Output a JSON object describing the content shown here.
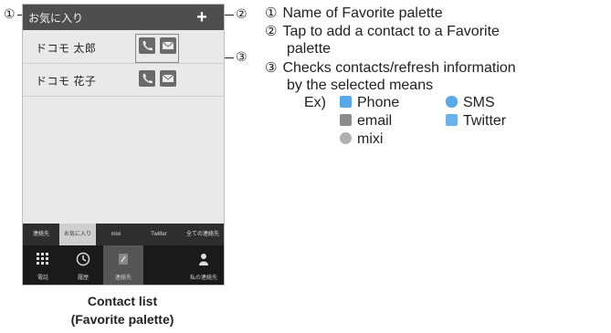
{
  "phone": {
    "palette_name": "お気に入り",
    "add_symbol": "+",
    "contacts": [
      {
        "name": "ドコモ 太郎"
      },
      {
        "name": "ドコモ 花子"
      }
    ],
    "tabs": [
      {
        "label": "連絡先"
      },
      {
        "label": "お気に入り"
      },
      {
        "label": "mixi"
      },
      {
        "label": "Twitter"
      },
      {
        "label": "全ての連絡先"
      }
    ],
    "bottom_tabs": [
      {
        "label": "電話",
        "icon": "dialpad-icon"
      },
      {
        "label": "履歴",
        "icon": "clock-icon"
      },
      {
        "label": "連絡先",
        "icon": "contacts-icon"
      },
      {
        "label": "",
        "icon": "blank"
      },
      {
        "label": "私の連絡先",
        "icon": "person-icon"
      }
    ]
  },
  "callouts": {
    "c1": "①",
    "c2": "②",
    "c3": "③"
  },
  "caption": {
    "line1": "Contact list",
    "line2": "(Favorite palette)"
  },
  "descriptions": [
    {
      "mark": "①",
      "text": "Name of Favorite palette"
    },
    {
      "mark": "②",
      "text": "Tap to add a contact to a Favorite"
    },
    {
      "mark": "",
      "text": "palette"
    },
    {
      "mark": "③",
      "text": "Checks contacts/refresh information"
    },
    {
      "mark": "",
      "text": "by the selected means"
    }
  ],
  "example": {
    "label": "Ex)",
    "items": [
      {
        "label": "Phone",
        "icon": "phone-icon",
        "color": "#5aa9e6"
      },
      {
        "label": "SMS",
        "icon": "sms-icon",
        "color": "#5aa9e6"
      },
      {
        "label": "email",
        "icon": "email-icon",
        "color": "#8c8c8c"
      },
      {
        "label": "Twitter",
        "icon": "twitter-icon",
        "color": "#6ab3e8"
      },
      {
        "label": "mixi",
        "icon": "mixi-icon",
        "color": "#b0b0b0"
      }
    ]
  }
}
